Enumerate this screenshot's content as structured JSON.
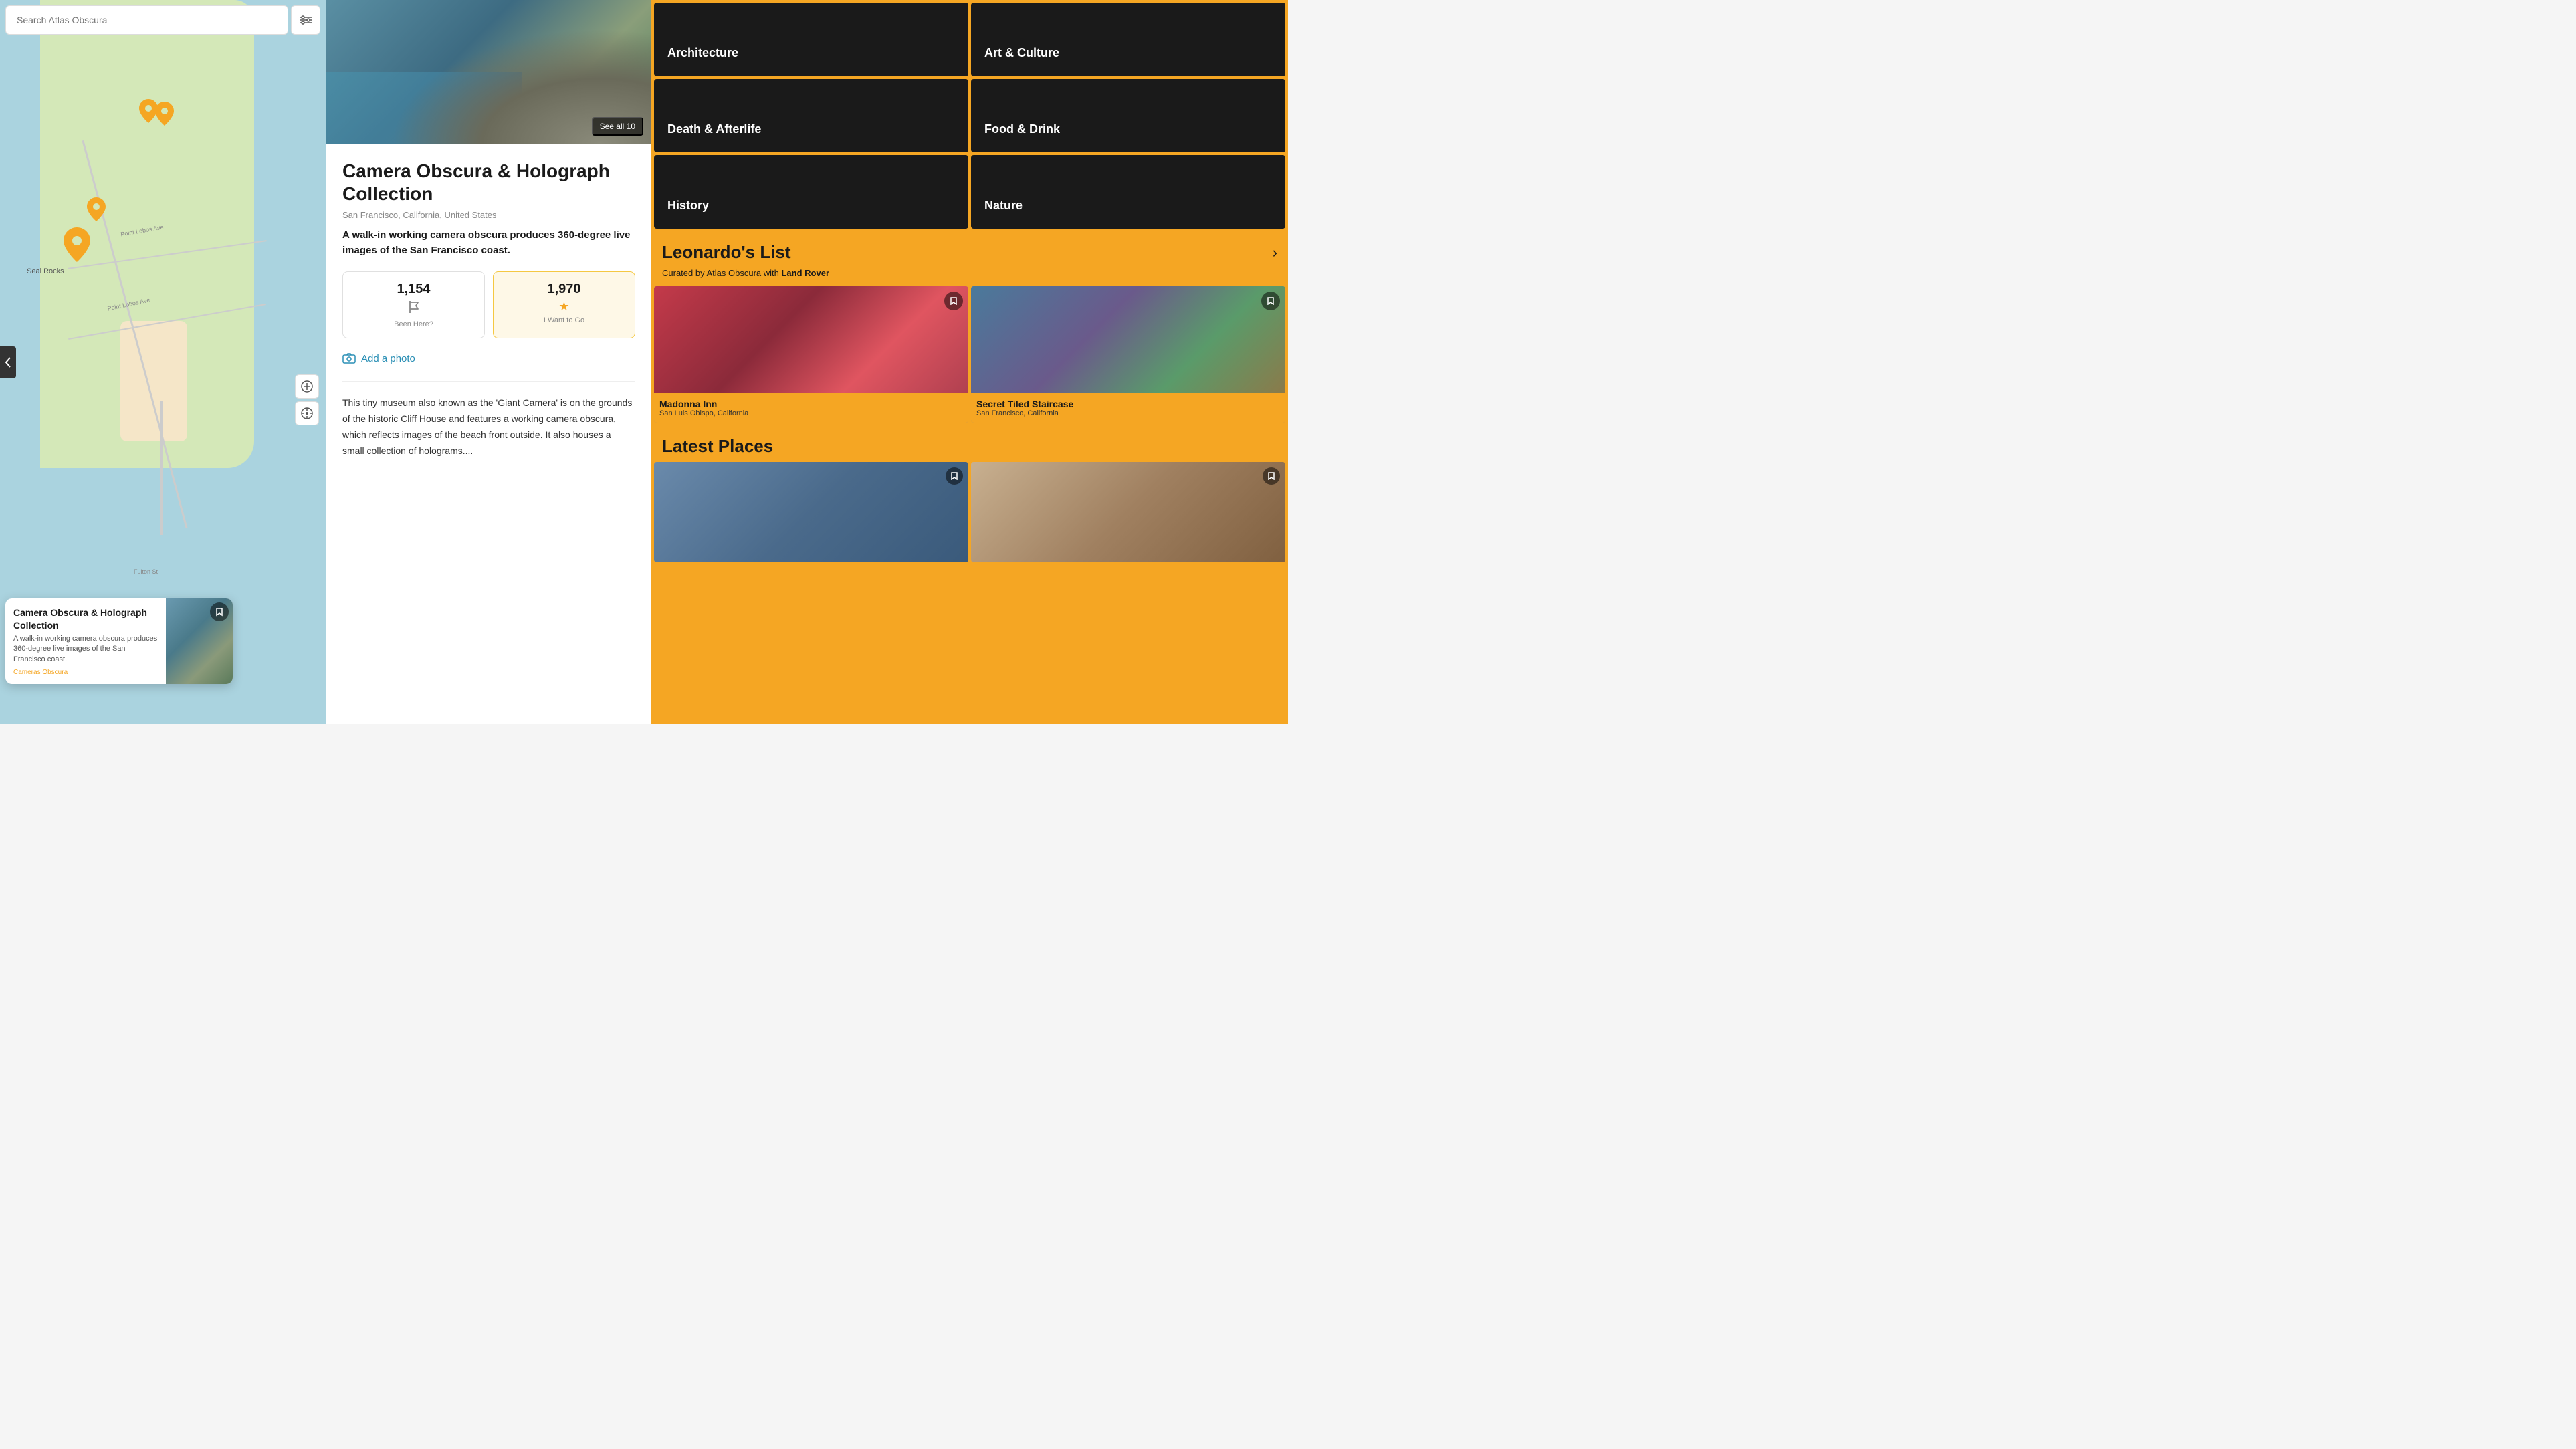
{
  "search": {
    "placeholder": "Search Atlas Obscura",
    "value": ""
  },
  "map": {
    "labels": {
      "seal_rocks": "Seal Rocks",
      "point_lobos": "Point Lobos Ave",
      "fulton": "Fulton St"
    },
    "popup": {
      "title": "Camera Obscura & Holograph Collection",
      "description": "A walk-in working camera obscura produces 360-degree live images of the San Francisco coast.",
      "tag": "Cameras Obscura"
    }
  },
  "detail": {
    "hero": {
      "see_all": "See all 10"
    },
    "title": "Camera Obscura & Holograph Collection",
    "location": "San Francisco, California, United States",
    "tagline": "A walk-in working camera obscura produces 360-degree live images of the San Francisco coast.",
    "stats": {
      "been_here": {
        "count": "1,154",
        "label": "Been Here?"
      },
      "want_to_go": {
        "count": "1,970",
        "label": "I Want to Go"
      }
    },
    "add_photo": "Add a photo",
    "description": "This tiny museum also known as the 'Giant Camera' is on the grounds of the historic Cliff House and features a working camera obscura, which reflects images of the beach front outside. It also houses a small collection of holograms...."
  },
  "sidebar": {
    "categories": [
      {
        "id": "architecture",
        "label": "Architecture"
      },
      {
        "id": "art-culture",
        "label": "Art & Culture"
      },
      {
        "id": "death-afterlife",
        "label": "Death & Afterlife"
      },
      {
        "id": "food-drink",
        "label": "Food & Drink"
      },
      {
        "id": "history",
        "label": "History"
      },
      {
        "id": "nature",
        "label": "Nature"
      }
    ],
    "leonardos_list": {
      "title": "Leonardo's List",
      "curator_text": "Curated by Atlas Obscura with",
      "curator_brand": "Land Rover",
      "places": [
        {
          "name": "Madonna Inn",
          "location": "San Luis Obispo, California"
        },
        {
          "name": "Secret Tiled Staircase",
          "location": "San Francisco, California"
        }
      ]
    },
    "latest_places": {
      "title": "Latest Places"
    }
  },
  "icons": {
    "search": "🔍",
    "filter": "⚙",
    "pin": "📍",
    "flag": "🏴",
    "star": "⭐",
    "camera": "📷",
    "bookmark": "🔖",
    "arrow_right": "›",
    "crosshair": "⊕",
    "add_location": "⊕"
  }
}
